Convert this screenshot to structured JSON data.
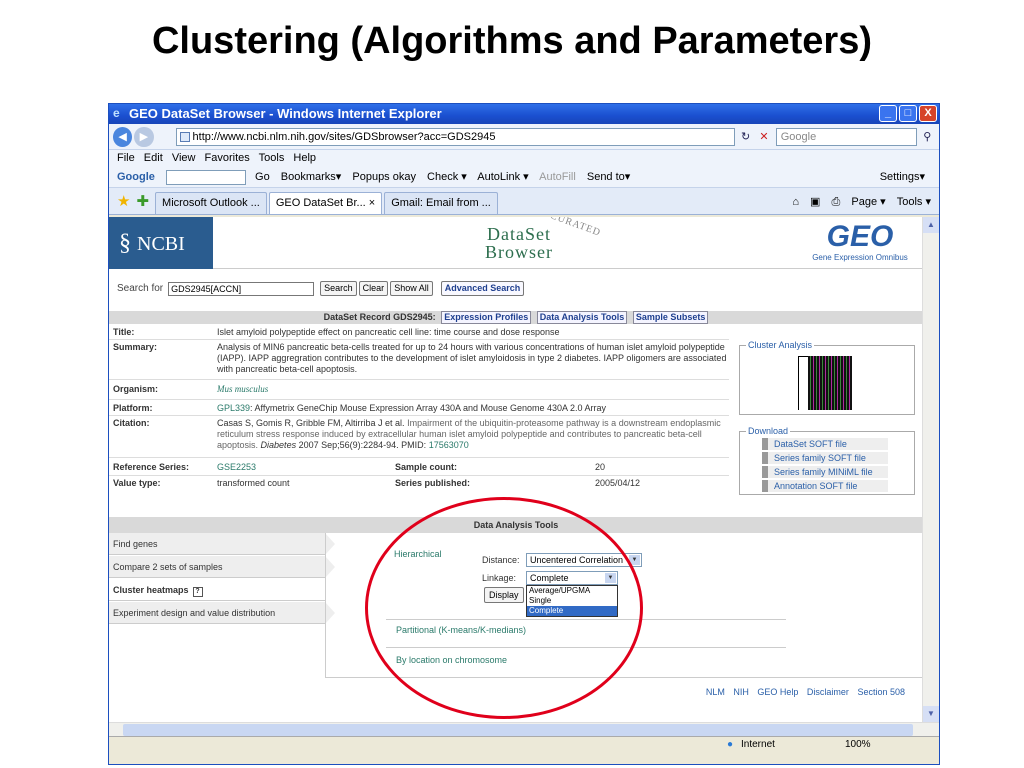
{
  "slide": {
    "title": "Clustering (Algorithms and Parameters)"
  },
  "window": {
    "title": "GEO DataSet Browser - Windows Internet Explorer",
    "buttons": {
      "minimize": "_",
      "maximize": "□",
      "close": "X"
    }
  },
  "address_bar": {
    "url": "http://www.ncbi.nlm.nih.gov/sites/GDSbrowser?acc=GDS2945",
    "search_placeholder": "Google"
  },
  "menu": [
    "File",
    "Edit",
    "View",
    "Favorites",
    "Tools",
    "Help"
  ],
  "google_toolbar": {
    "label": "Google",
    "items": [
      "Go",
      "Bookmarks▾",
      "Popups okay",
      "Check ▾",
      "AutoLink ▾",
      "AutoFill",
      "Send to▾"
    ],
    "settings": "Settings▾"
  },
  "tabs": [
    {
      "label": "Microsoft Outlook ..."
    },
    {
      "label": "GEO DataSet Br... ×",
      "active": true
    },
    {
      "label": "Gmail: Email from ..."
    }
  ],
  "tab_tools": [
    "Page ▾",
    "Tools ▾"
  ],
  "page": {
    "ncbi_logo": "NCBI",
    "dataset_title_line1": "DataSet",
    "dataset_title_line2": "Browser",
    "curated": "CURATED",
    "geo_logo": "GEO",
    "geo_sub": "Gene Expression Omnibus",
    "search": {
      "label": "Search for",
      "value": "GDS2945[ACCN]",
      "buttons": [
        "Search",
        "Clear",
        "Show All"
      ],
      "advanced": "Advanced Search"
    },
    "record": {
      "header": "DataSet Record GDS2945:",
      "header_links": [
        "Expression Profiles",
        "Data Analysis Tools",
        "Sample Subsets"
      ],
      "title_label": "Title:",
      "title": "Islet amyloid polypeptide effect on pancreatic cell line: time course and dose response",
      "summary_label": "Summary:",
      "summary": "Analysis of MIN6 pancreatic beta-cells treated for up to 24 hours with various concentrations of human islet amyloid polypeptide (IAPP). IAPP aggregration contributes to the development of islet amyloidosis in type 2 diabetes. IAPP oligomers are associated with pancreatic beta-cell apoptosis.",
      "organism_label": "Organism:",
      "organism": "Mus musculus",
      "platform_label": "Platform:",
      "platform_id": "GPL339",
      "platform": ": Affymetrix GeneChip Mouse Expression Array 430A and Mouse Genome 430A 2.0 Array",
      "citation_label": "Citation:",
      "citation_authors": "Casas S, Gomis R, Gribble FM, Altirriba J et al.",
      "citation_title": "Impairment of the ubiquitin-proteasome pathway is a downstream endoplasmic reticulum stress response induced by extracellular human islet amyloid polypeptide and contributes to pancreatic beta-cell apoptosis.",
      "citation_journal": "Diabetes",
      "citation_ref": "2007 Sep;56(9):2284-94. PMID:",
      "citation_pmid": "17563070",
      "ref_series_label": "Reference Series:",
      "ref_series": "GSE2253",
      "sample_count_label": "Sample count:",
      "sample_count": "20",
      "value_type_label": "Value type:",
      "value_type": "transformed count",
      "series_published_label": "Series published:",
      "series_published": "2005/04/12"
    },
    "cluster_analysis": {
      "title": "Cluster Analysis"
    },
    "download": {
      "title": "Download",
      "items": [
        "DataSet SOFT file",
        "Series family SOFT file",
        "Series family MINiML file",
        "Annotation SOFT file"
      ]
    },
    "tools": {
      "header": "Data Analysis Tools",
      "left_tabs": [
        "Find genes",
        "Compare 2 sets of samples",
        "Cluster heatmaps",
        "Experiment design and value distribution"
      ],
      "help_icon": "?",
      "hierarchical": "Hierarchical",
      "distance_label": "Distance:",
      "distance_value": "Uncentered Correlation",
      "linkage_label": "Linkage:",
      "linkage_value": "Complete",
      "linkage_options": [
        "Average/UPGMA",
        "Single",
        "Complete"
      ],
      "display_button": "Display",
      "partitional": "Partitional (K-means/K-medians)",
      "by_location": "By location on chromosome"
    },
    "footer_links": [
      "NLM",
      "NIH",
      "GEO Help",
      "Disclaimer",
      "Section 508"
    ]
  },
  "status": {
    "zone": "Internet",
    "zoom": "100%"
  },
  "colors": {
    "annotation": "#e0001b",
    "titlebar": "#1a4fcf",
    "ncbi": "#2a5c8f",
    "link": "#2a7a6a"
  }
}
